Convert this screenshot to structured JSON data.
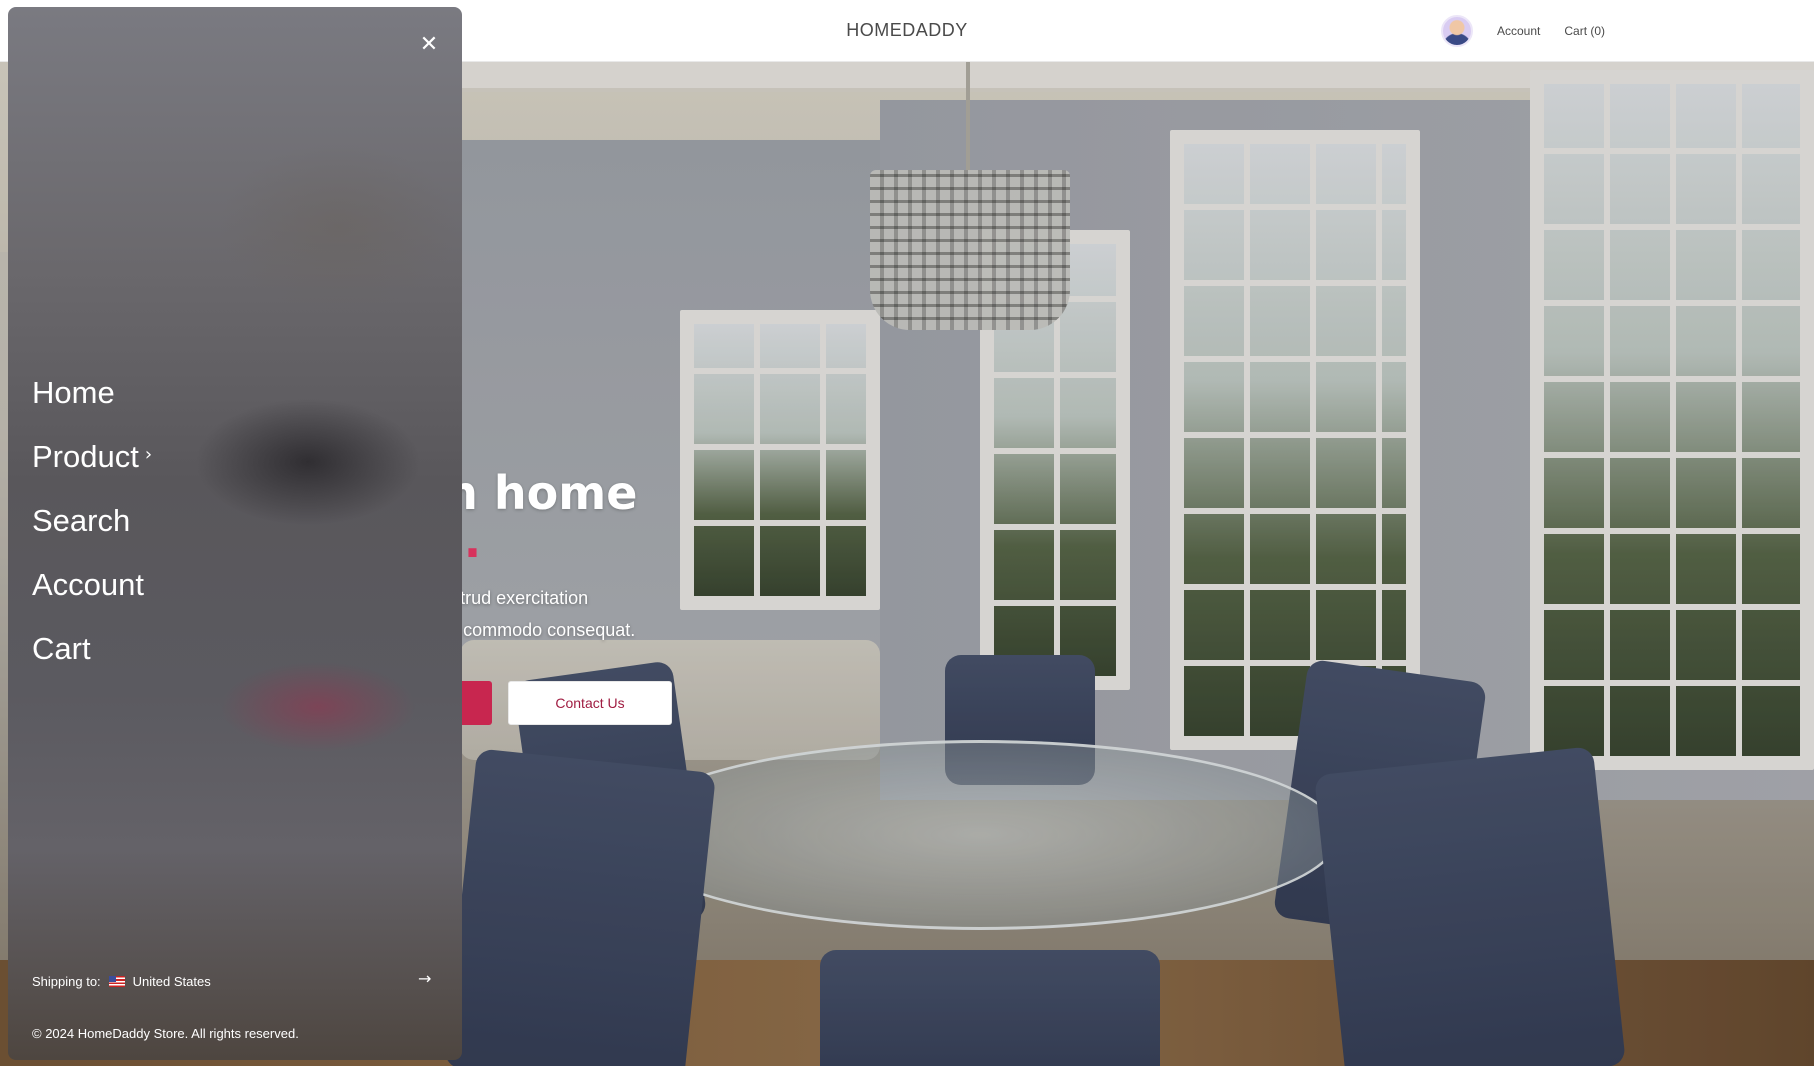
{
  "header": {
    "brand": "HOMEDADDY",
    "account_label": "Account",
    "cart_label": "Cart (0)"
  },
  "hero": {
    "headline_line1": "Your dream home",
    "headline_line2": "Awaits You.",
    "body_line1": "Ut enim ad minim veniam, quis nostrud exercitation",
    "body_line2": "ullamco laboris nisi ut aliquip ex ea commodo consequat.",
    "contact_button": "Contact Us",
    "accent_color": "#d7325c"
  },
  "drawer": {
    "close_icon": "close-icon",
    "items": [
      {
        "label": "Home"
      },
      {
        "label": "Product",
        "has_submenu": true
      },
      {
        "label": "Search"
      },
      {
        "label": "Account"
      },
      {
        "label": "Cart"
      }
    ],
    "shipping_label": "Shipping to:",
    "shipping_country": "United States",
    "shipping_flag_icon": "us-flag-icon",
    "shipping_arrow_icon": "arrow-right-icon",
    "copyright": "© 2024 HomeDaddy Store. All rights reserved."
  }
}
